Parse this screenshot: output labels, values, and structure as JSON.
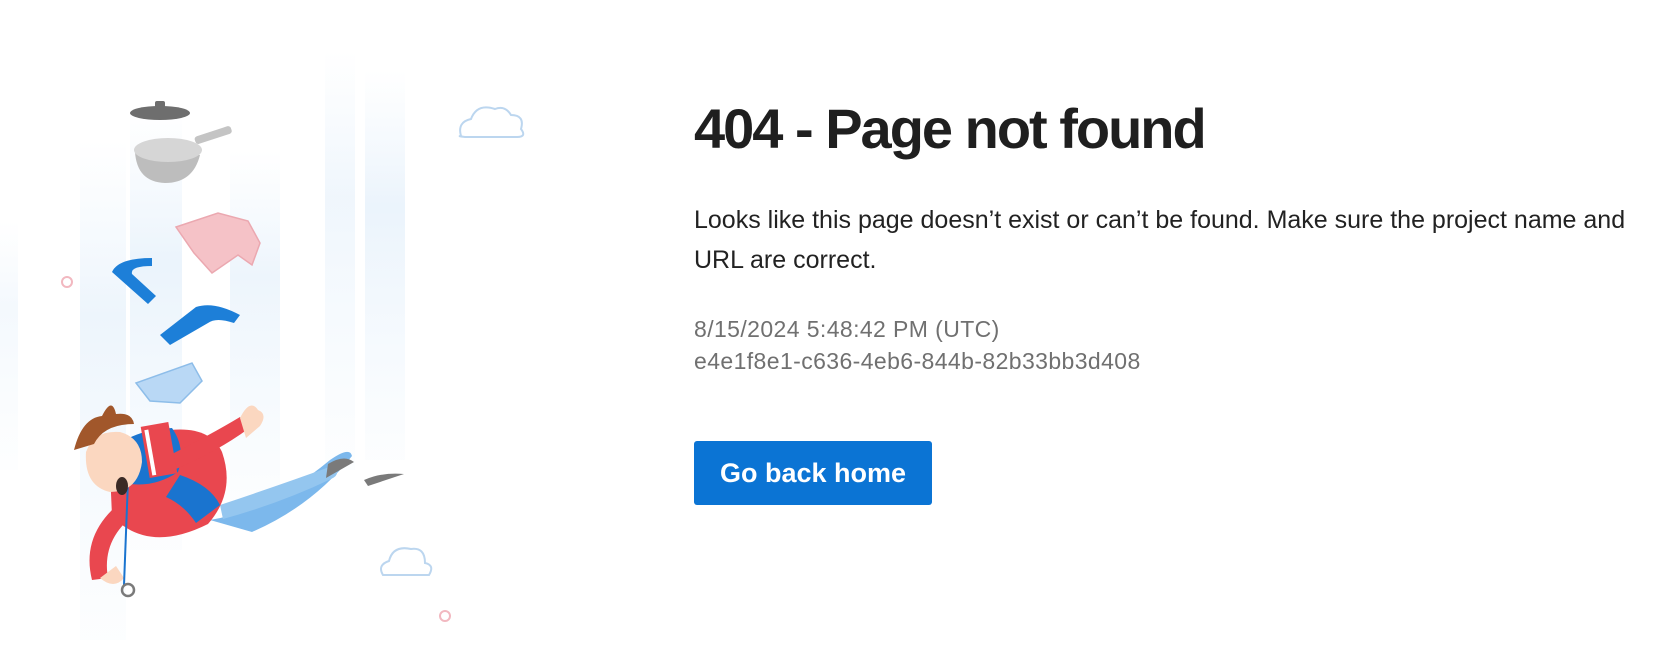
{
  "error": {
    "title": "404 - Page not found",
    "message": "Looks like this page doesn’t exist or can’t be found. Make sure the project name and URL are correct.",
    "timestamp": "8/15/2024 5:48:42 PM (UTC)",
    "activity_id": "e4e1f8e1-c636-4eb6-844b-82b33bb3d408"
  },
  "actions": {
    "home_label": "Go back home"
  },
  "colors": {
    "accent": "#0b74d4",
    "title_text": "#1f1f1f",
    "meta_text": "#707070"
  },
  "illustration": {
    "icon": "falling-person-illustration"
  }
}
